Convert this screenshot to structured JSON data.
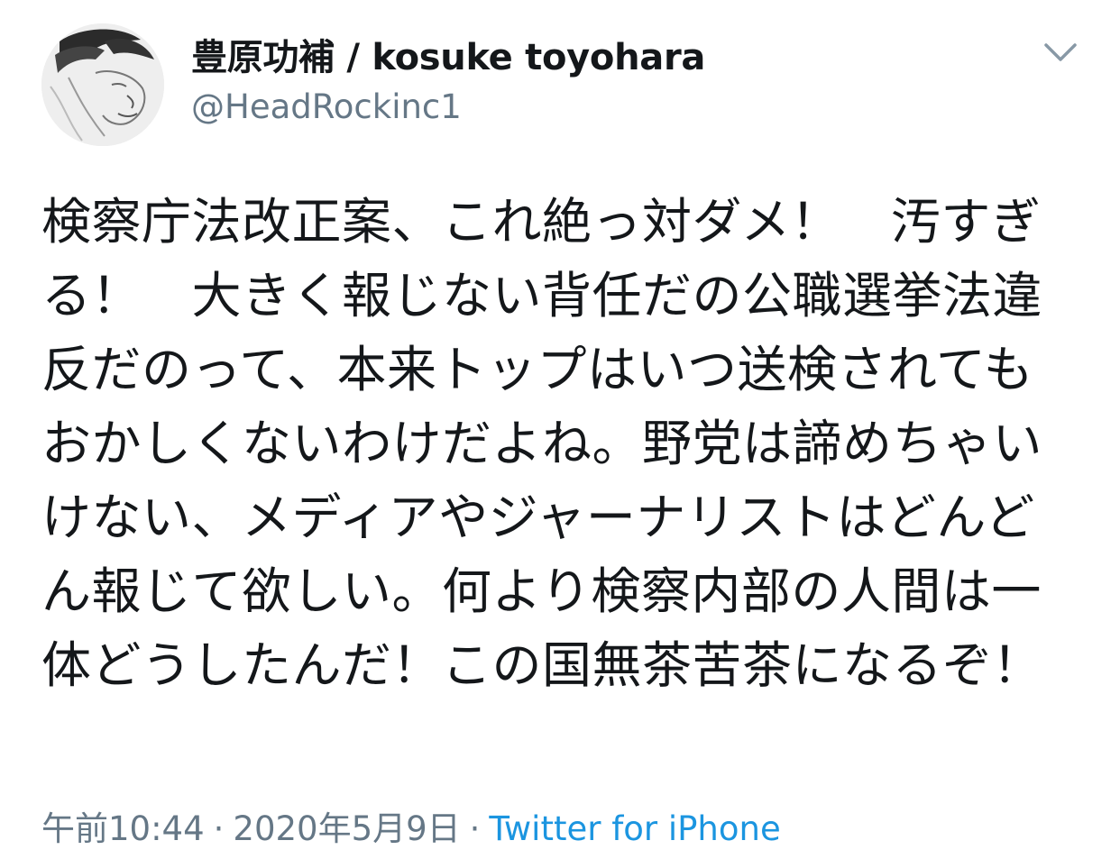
{
  "user": {
    "display_name": "豊原功補 / kosuke toyohara",
    "handle": "@HeadRockinc1",
    "avatar_icon": "avatar-portrait-sketch"
  },
  "menu": {
    "icon": "chevron-down-icon"
  },
  "tweet": {
    "text": "検察庁法改正案、これ絶っ対ダメ！　汚すぎる！　大きく報じない背任だの公職選挙法違反だのって、本来トップはいつ送検されてもおかしくないわけだよね。野党は諦めちゃいけない、メディアやジャーナリストはどんどん報じて欲しい。何より検察内部の人間は一体どうしたんだ！この国無茶苦茶になるぞ！",
    "time": "午前10:44",
    "separator": "·",
    "date": "2020年5月9日",
    "source": "Twitter for iPhone"
  },
  "colors": {
    "text": "#14171a",
    "secondary": "#657786",
    "link": "#1b95e0"
  }
}
